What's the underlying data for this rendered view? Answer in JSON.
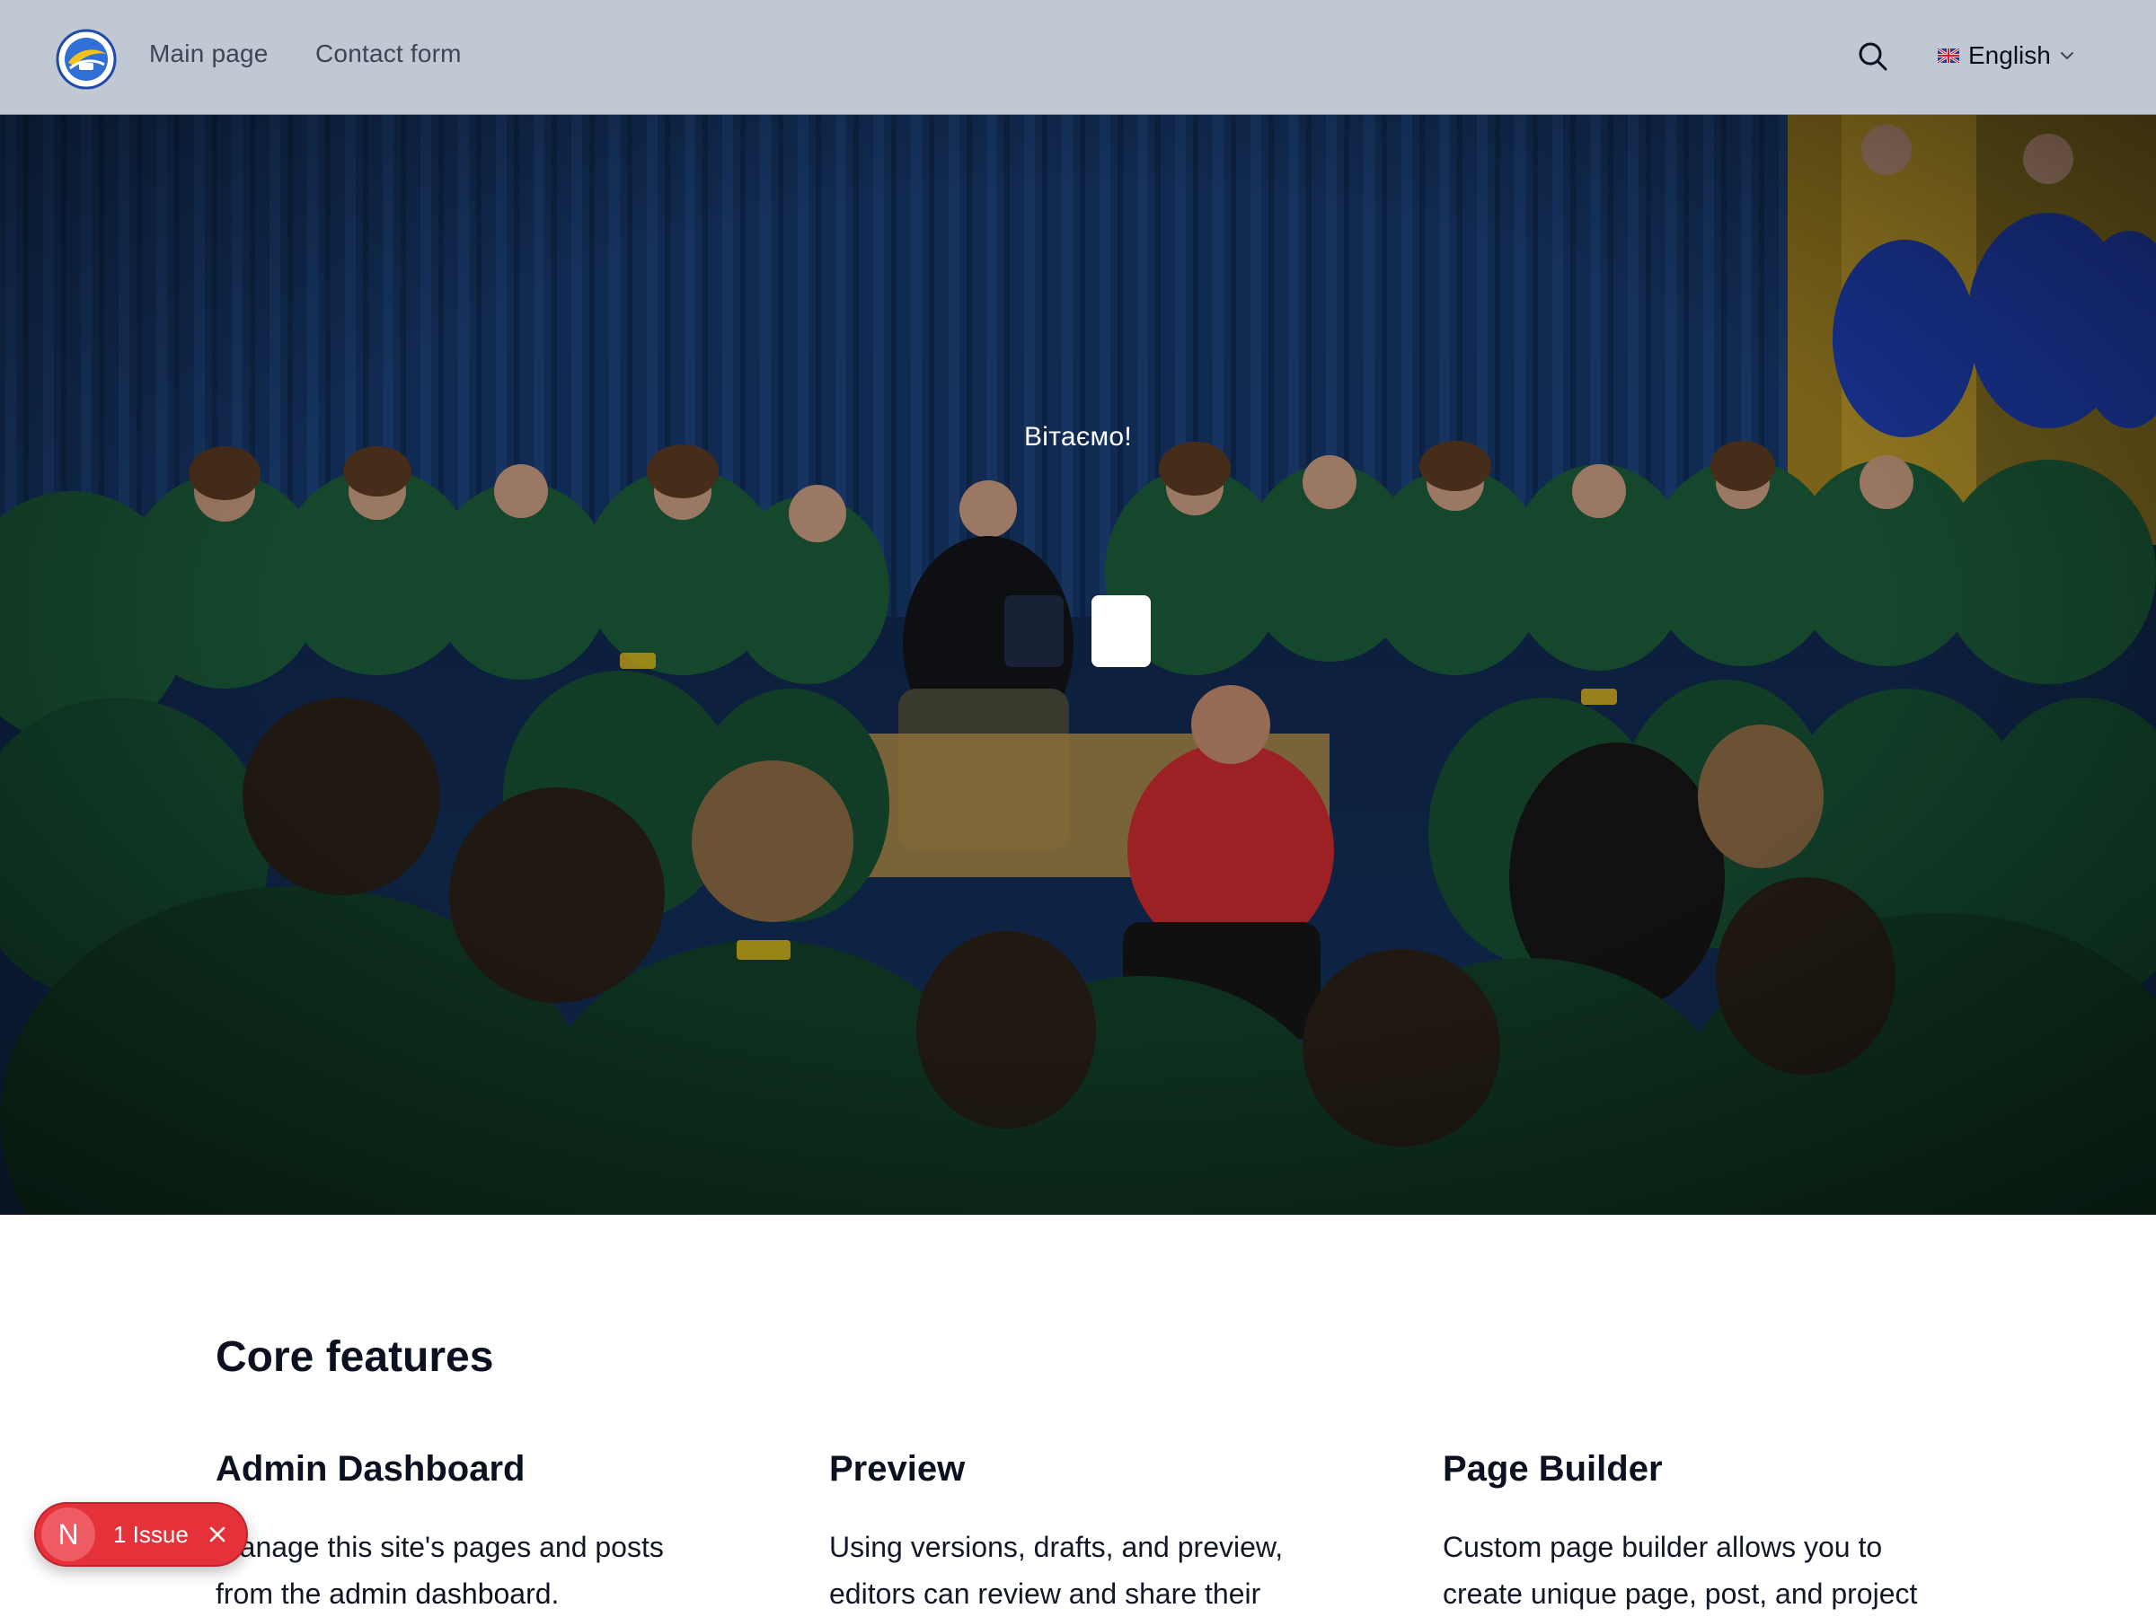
{
  "header": {
    "nav": [
      {
        "label": "Main page"
      },
      {
        "label": "Contact form"
      }
    ],
    "search_icon": "search-icon",
    "language": {
      "label": "English",
      "flag": "uk-flag-icon",
      "icon": "chevron-down-icon"
    }
  },
  "hero": {
    "title": "Вітаємо!",
    "buttons": [
      {
        "style": "dark"
      },
      {
        "style": "light"
      }
    ],
    "colors": {
      "curtain": "#1d3f78",
      "hoodie": "#1c5c3a",
      "accent": "#f0c419"
    }
  },
  "features": {
    "title": "Core features",
    "items": [
      {
        "title": "Admin Dashboard",
        "text_before": "Manage this site's pages and posts from the ",
        "link": "admin dashboard",
        "text_after": "."
      },
      {
        "title": "Preview",
        "text": "Using versions, drafts, and preview, editors can review and share their"
      },
      {
        "title": "Page Builder",
        "text": "Custom page builder allows you to create unique page, post, and project"
      }
    ]
  },
  "issue_badge": {
    "initial": "N",
    "text": "1 Issue",
    "color": "#e5323a"
  }
}
